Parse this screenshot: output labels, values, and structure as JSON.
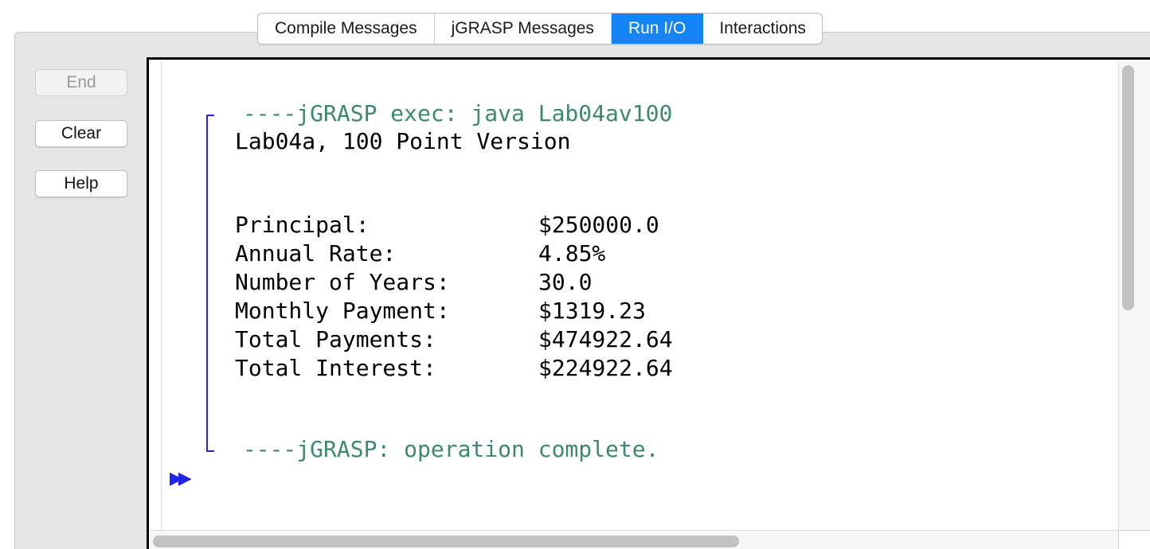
{
  "tabs": [
    {
      "label": "Compile Messages",
      "active": false
    },
    {
      "label": "jGRASP Messages",
      "active": false
    },
    {
      "label": "Run I/O",
      "active": true
    },
    {
      "label": "Interactions",
      "active": false
    }
  ],
  "side_buttons": {
    "end": {
      "label": "End",
      "enabled": false
    },
    "clear": {
      "label": "Clear",
      "enabled": true
    },
    "help": {
      "label": "Help",
      "enabled": true
    }
  },
  "console": {
    "exec_line": " ----jGRASP exec: java Lab04av100",
    "title_line": "Lab04a, 100 Point Version",
    "rows": [
      {
        "label": "Principal:",
        "value": "$250000.0"
      },
      {
        "label": "Annual Rate:",
        "value": "4.85%"
      },
      {
        "label": "Number of Years:",
        "value": "30.0"
      },
      {
        "label": "Monthly Payment:",
        "value": "$1319.23"
      },
      {
        "label": "Total Payments:",
        "value": "$474922.64"
      },
      {
        "label": "Total Interest:",
        "value": "$224922.64"
      }
    ],
    "complete_line": " ----jGRASP: operation complete.",
    "prompt_icon": "double-play-arrow-icon"
  },
  "colors": {
    "active_tab": "#1584f5",
    "jgrasp_green": "#3c8a6a",
    "bracket_blue": "#2b1fe0",
    "prompt_blue": "#2323e8"
  }
}
